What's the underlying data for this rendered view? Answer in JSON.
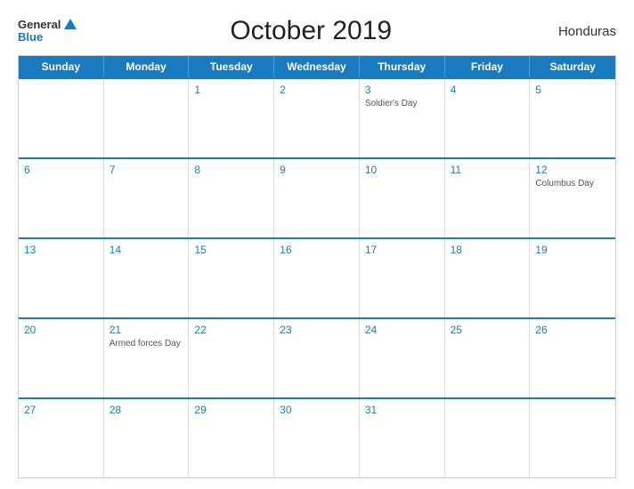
{
  "header": {
    "logo_general": "General",
    "logo_blue": "Blue",
    "title": "October 2019",
    "country": "Honduras"
  },
  "calendar": {
    "days_of_week": [
      "Sunday",
      "Monday",
      "Tuesday",
      "Wednesday",
      "Thursday",
      "Friday",
      "Saturday"
    ],
    "weeks": [
      [
        {
          "day": "",
          "event": ""
        },
        {
          "day": "",
          "event": ""
        },
        {
          "day": "1",
          "event": ""
        },
        {
          "day": "2",
          "event": ""
        },
        {
          "day": "3",
          "event": "Soldier's Day"
        },
        {
          "day": "4",
          "event": ""
        },
        {
          "day": "5",
          "event": ""
        }
      ],
      [
        {
          "day": "6",
          "event": ""
        },
        {
          "day": "7",
          "event": ""
        },
        {
          "day": "8",
          "event": ""
        },
        {
          "day": "9",
          "event": ""
        },
        {
          "day": "10",
          "event": ""
        },
        {
          "day": "11",
          "event": ""
        },
        {
          "day": "12",
          "event": "Columbus Day"
        }
      ],
      [
        {
          "day": "13",
          "event": ""
        },
        {
          "day": "14",
          "event": ""
        },
        {
          "day": "15",
          "event": ""
        },
        {
          "day": "16",
          "event": ""
        },
        {
          "day": "17",
          "event": ""
        },
        {
          "day": "18",
          "event": ""
        },
        {
          "day": "19",
          "event": ""
        }
      ],
      [
        {
          "day": "20",
          "event": ""
        },
        {
          "day": "21",
          "event": "Armed forces Day"
        },
        {
          "day": "22",
          "event": ""
        },
        {
          "day": "23",
          "event": ""
        },
        {
          "day": "24",
          "event": ""
        },
        {
          "day": "25",
          "event": ""
        },
        {
          "day": "26",
          "event": ""
        }
      ],
      [
        {
          "day": "27",
          "event": ""
        },
        {
          "day": "28",
          "event": ""
        },
        {
          "day": "29",
          "event": ""
        },
        {
          "day": "30",
          "event": ""
        },
        {
          "day": "31",
          "event": ""
        },
        {
          "day": "",
          "event": ""
        },
        {
          "day": "",
          "event": ""
        }
      ]
    ]
  }
}
